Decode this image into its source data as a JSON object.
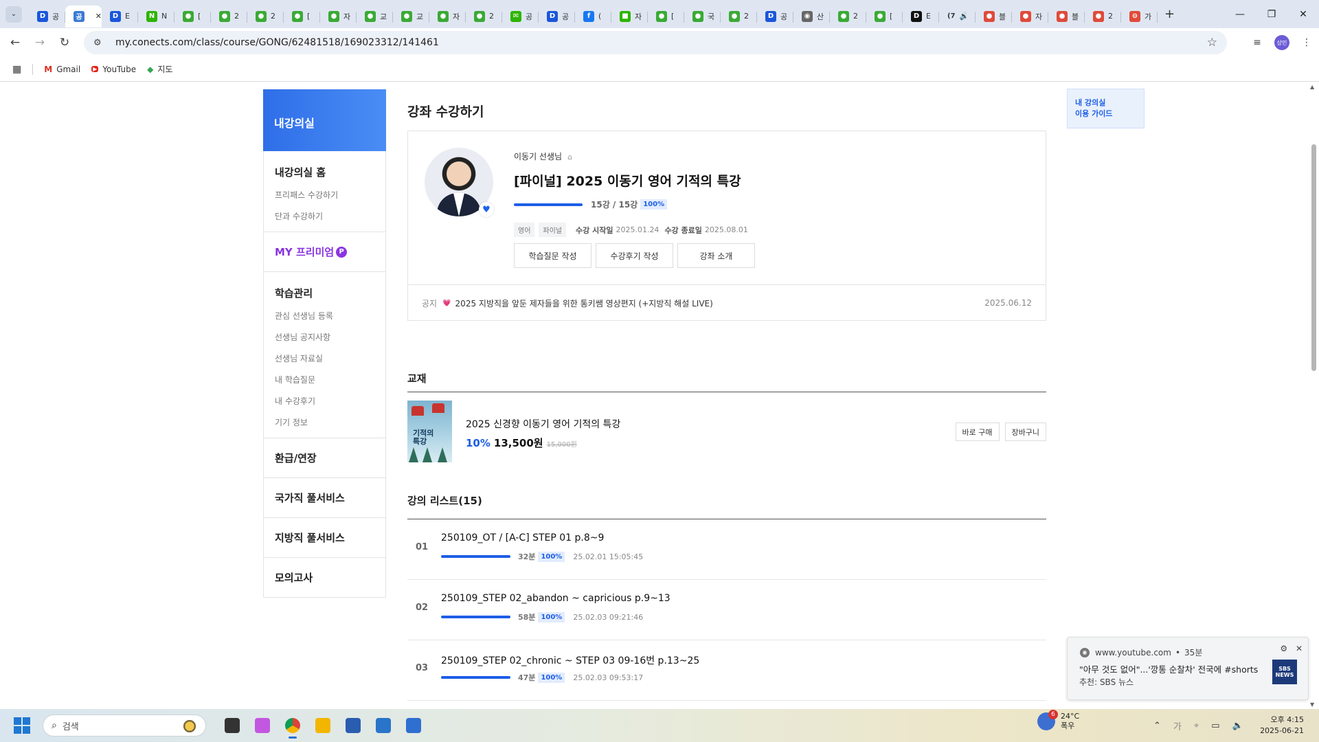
{
  "browser": {
    "tabs": [
      {
        "icon": "D",
        "color": "#1a56db",
        "text": "공"
      },
      {
        "icon": "공",
        "color": "#3a7bd5",
        "text": "",
        "active": true
      },
      {
        "icon": "D",
        "color": "#1a56db",
        "text": "E"
      },
      {
        "icon": "N",
        "color": "#2db400",
        "text": "N"
      },
      {
        "icon": "●",
        "color": "#3aaa35",
        "text": "["
      },
      {
        "icon": "●",
        "color": "#3aaa35",
        "text": "2"
      },
      {
        "icon": "●",
        "color": "#3aaa35",
        "text": "2"
      },
      {
        "icon": "●",
        "color": "#3aaa35",
        "text": "["
      },
      {
        "icon": "●",
        "color": "#3aaa35",
        "text": "자"
      },
      {
        "icon": "●",
        "color": "#3aaa35",
        "text": "교"
      },
      {
        "icon": "●",
        "color": "#3aaa35",
        "text": "교"
      },
      {
        "icon": "●",
        "color": "#3aaa35",
        "text": "자"
      },
      {
        "icon": "●",
        "color": "#3aaa35",
        "text": "2"
      },
      {
        "icon": "✉",
        "color": "#2db400",
        "text": "공"
      },
      {
        "icon": "D",
        "color": "#1a56db",
        "text": "공"
      },
      {
        "icon": "f",
        "color": "#1877f2",
        "text": "("
      },
      {
        "icon": "■",
        "color": "#2db400",
        "text": "자"
      },
      {
        "icon": "●",
        "color": "#3aaa35",
        "text": "["
      },
      {
        "icon": "●",
        "color": "#3aaa35",
        "text": "국"
      },
      {
        "icon": "●",
        "color": "#3aaa35",
        "text": "2"
      },
      {
        "icon": "D",
        "color": "#1a56db",
        "text": "공"
      },
      {
        "icon": "◉",
        "color": "#666666",
        "text": "산"
      },
      {
        "icon": "●",
        "color": "#3aaa35",
        "text": "2"
      },
      {
        "icon": "●",
        "color": "#3aaa35",
        "text": "["
      },
      {
        "icon": "D",
        "color": "#111111",
        "text": "E"
      },
      {
        "icon": "(7",
        "color": "transparent",
        "text": "🔊"
      },
      {
        "icon": "●",
        "color": "#e04a3a",
        "text": "블"
      },
      {
        "icon": "●",
        "color": "#e04a3a",
        "text": "자"
      },
      {
        "icon": "●",
        "color": "#e04a3a",
        "text": "블"
      },
      {
        "icon": "●",
        "color": "#e04a3a",
        "text": "2"
      },
      {
        "icon": "⊖",
        "color": "#e04a3a",
        "text": "가"
      }
    ],
    "url": "my.conects.com/class/course/GONG/62481518/169023312/141461",
    "profile": "상민",
    "bookmarks": [
      {
        "icon": "M",
        "label": "Gmail"
      },
      {
        "icon": "▶",
        "label": "YouTube"
      },
      {
        "icon": "◆",
        "label": "지도"
      }
    ]
  },
  "sidebar": {
    "header": "내강의실",
    "sections": [
      {
        "title": "내강의실 홈",
        "links": [
          "프리패스 수강하기",
          "단과 수강하기"
        ]
      },
      {
        "title": "MY 프리미엄",
        "badge": "P",
        "premium": true,
        "links": []
      },
      {
        "title": "학습관리",
        "links": [
          "관심 선생님 등록",
          "선생님 공지사항",
          "선생님 자료실",
          "내 학습질문",
          "내 수강후기",
          "기기 정보"
        ]
      },
      {
        "title": "환급/연장",
        "links": []
      },
      {
        "title": "국가직 풀서비스",
        "links": []
      },
      {
        "title": "지방직 풀서비스",
        "links": []
      },
      {
        "title": "모의고사",
        "links": []
      }
    ]
  },
  "main": {
    "page_title": "강좌 수강하기",
    "course": {
      "teacher": "이동기 선생님",
      "title": "[파이널] 2025 이동기 영어 기적의 특강",
      "progress": 1.0,
      "count": "15강 / 15강",
      "percent": "100%",
      "tags": [
        "영어",
        "파이널"
      ],
      "start_label": "수강 시작일",
      "start_date": "2025.01.24",
      "end_label": "수강 종료일",
      "end_date": "2025.08.01",
      "buttons": [
        "학습질문 작성",
        "수강후기 작성",
        "강좌 소개"
      ]
    },
    "notice": {
      "label": "공지",
      "text": "2025 지방직을 앞둔 제자들을 위한 통키쌤 영상편지 (+지방직 해설 LIVE)",
      "date": "2025.06.12"
    },
    "textbook": {
      "section_title": "교재",
      "cover_text": "기적의\n특강",
      "name": "2025 신경향 이동기 영어 기적의 특강",
      "discount": "10%",
      "price": "13,500원",
      "original_price": "15,000원",
      "buy_label": "바로 구매",
      "cart_label": "장바구니"
    },
    "lectures": {
      "section_title": "강의 리스트(15)",
      "items": [
        {
          "no": "01",
          "title": "250109_OT / [A-C] STEP 01 p.8~9",
          "progress": 1.0,
          "duration": "32분",
          "percent": "100%",
          "watched": "25.02.01 15:05:45"
        },
        {
          "no": "02",
          "title": "250109_STEP 02_abandon ~ capricious p.9~13",
          "progress": 1.0,
          "duration": "58분",
          "percent": "100%",
          "watched": "25.02.03 09:21:46"
        },
        {
          "no": "03",
          "title": "250109_STEP 02_chronic ~ STEP 03 09-16번 p.13~25",
          "progress": 1.0,
          "duration": "47분",
          "percent": "100%",
          "watched": "25.02.03 09:53:17"
        }
      ]
    }
  },
  "guide": {
    "line1": "내 강의실",
    "line2": "이용 가이드"
  },
  "toast": {
    "source": "www.youtube.com",
    "age": "35분",
    "message": "\"아무 것도 없어\"...'깡통 순찰차' 전국에 #shorts",
    "sub": "추천: SBS 뉴스",
    "logo": "SBS NEWS"
  },
  "taskbar": {
    "search_placeholder": "검색",
    "weather_temp": "24°C",
    "weather_desc": "폭우",
    "weather_badge": "6",
    "time": "오후 4:15",
    "date": "2025-06-21",
    "apps": [
      {
        "name": "task-view",
        "color": "#333333"
      },
      {
        "name": "copilot",
        "color": "#c257e0"
      },
      {
        "name": "chrome",
        "color": "#db4437",
        "active": true
      },
      {
        "name": "file-explorer",
        "color": "#f2b600"
      },
      {
        "name": "app-blue",
        "color": "#2a5db0"
      },
      {
        "name": "app-store",
        "color": "#2a74c9"
      },
      {
        "name": "notepad",
        "color": "#2f6fd0"
      }
    ]
  }
}
